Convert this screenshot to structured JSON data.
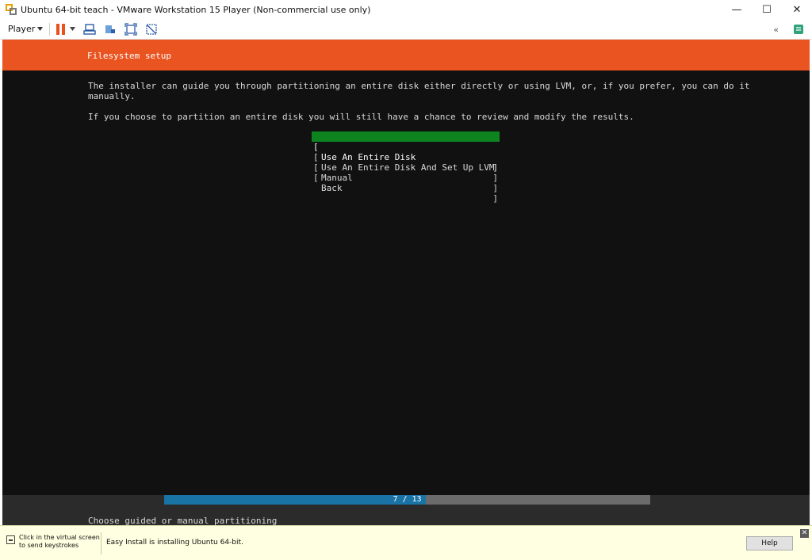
{
  "window": {
    "title": "Ubuntu 64-bit teach - VMware Workstation 15 Player (Non-commercial use only)",
    "minimize": "—",
    "maximize": "☐",
    "close": "✕"
  },
  "toolbar": {
    "player_label": "Player",
    "collapse_glyph": "«"
  },
  "installer": {
    "header": "Filesystem setup",
    "intro_line1": "The installer can guide you through partitioning an entire disk either directly or using LVM, or, if you prefer, you can do it",
    "intro_line2": "manually.",
    "intro_line3": "If you choose to partition an entire disk you will still have a chance to review and modify the results.",
    "options": [
      {
        "label": "Use An Entire Disk",
        "selected": true
      },
      {
        "label": "Use An Entire Disk And Set Up LVM",
        "selected": false
      },
      {
        "label": "Manual",
        "selected": false
      },
      {
        "label": "Back",
        "selected": false
      }
    ],
    "bracket_open": "[",
    "bracket_close": "]",
    "progress": {
      "current": 7,
      "total": 13,
      "text": "7 / 13"
    },
    "status": "Choose guided or manual partitioning"
  },
  "hint_bar": {
    "click_line1": "Click in the virtual screen",
    "click_line2": "to send keystrokes",
    "message": "Easy Install is installing Ubuntu 64-bit.",
    "help_label": "Help",
    "close_glyph": "✕"
  },
  "colors": {
    "ubuntu_orange": "#e95420",
    "selection_green": "#0e8420",
    "progress_blue": "#1a73a5",
    "pause_orange": "#e8501e"
  }
}
